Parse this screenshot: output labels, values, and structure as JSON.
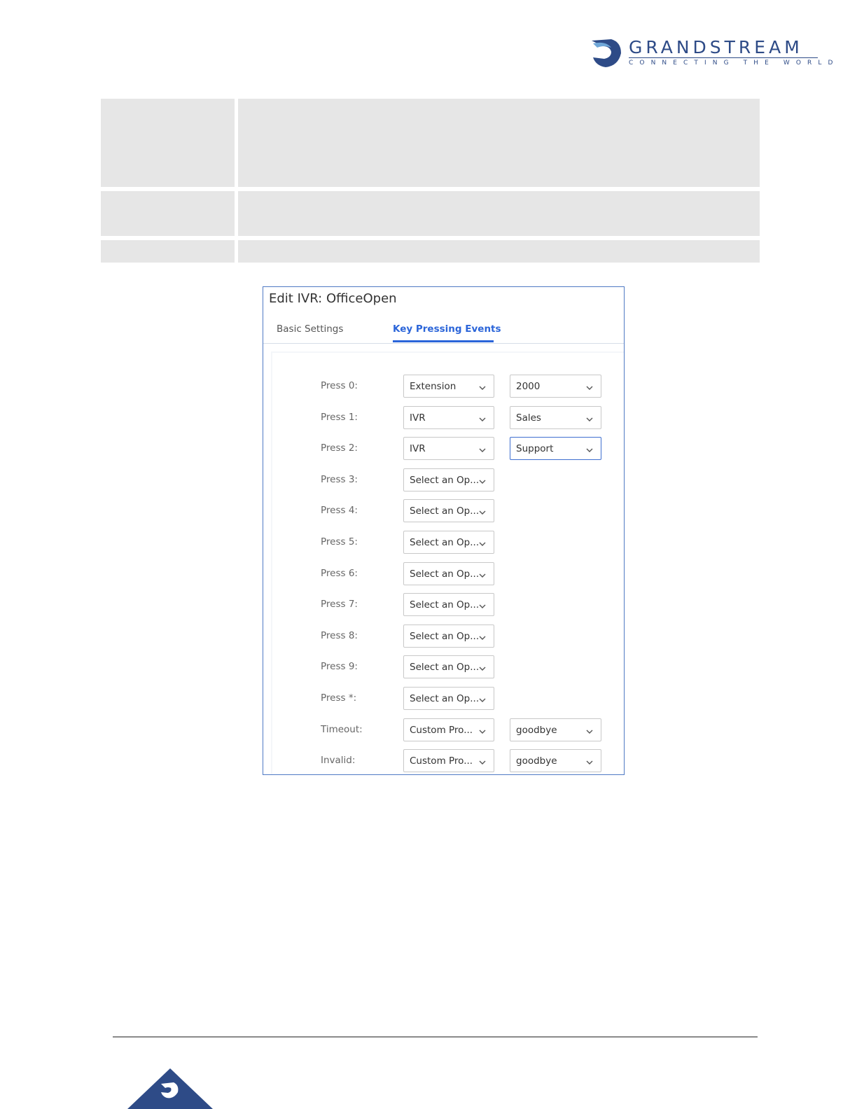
{
  "brand": {
    "name": "GRANDSTREAM",
    "tagline": "CONNECTING THE WORLD",
    "colors": {
      "primary": "#2e4b87",
      "accent": "#2b65d9"
    }
  },
  "dialog": {
    "title": "Edit IVR: OfficeOpen",
    "tabs": [
      {
        "label": "Basic Settings",
        "active": false
      },
      {
        "label": "Key Pressing Events",
        "active": true
      }
    ],
    "rows": [
      {
        "label": "Press 0:",
        "action": "Extension",
        "target": "2000"
      },
      {
        "label": "Press 1:",
        "action": "IVR",
        "target": "Sales"
      },
      {
        "label": "Press 2:",
        "action": "IVR",
        "target": "Support"
      },
      {
        "label": "Press 3:",
        "action": "Select an Op...",
        "target": null
      },
      {
        "label": "Press 4:",
        "action": "Select an Op...",
        "target": null
      },
      {
        "label": "Press 5:",
        "action": "Select an Op...",
        "target": null
      },
      {
        "label": "Press 6:",
        "action": "Select an Op...",
        "target": null
      },
      {
        "label": "Press 7:",
        "action": "Select an Op...",
        "target": null
      },
      {
        "label": "Press 8:",
        "action": "Select an Op...",
        "target": null
      },
      {
        "label": "Press 9:",
        "action": "Select an Op...",
        "target": null
      },
      {
        "label": "Press *:",
        "action": "Select an Op...",
        "target": null
      },
      {
        "label": "Timeout:",
        "action": "Custom Pro...",
        "target": "goodbye"
      },
      {
        "label": "Invalid:",
        "action": "Custom Pro...",
        "target": "goodbye"
      }
    ]
  }
}
